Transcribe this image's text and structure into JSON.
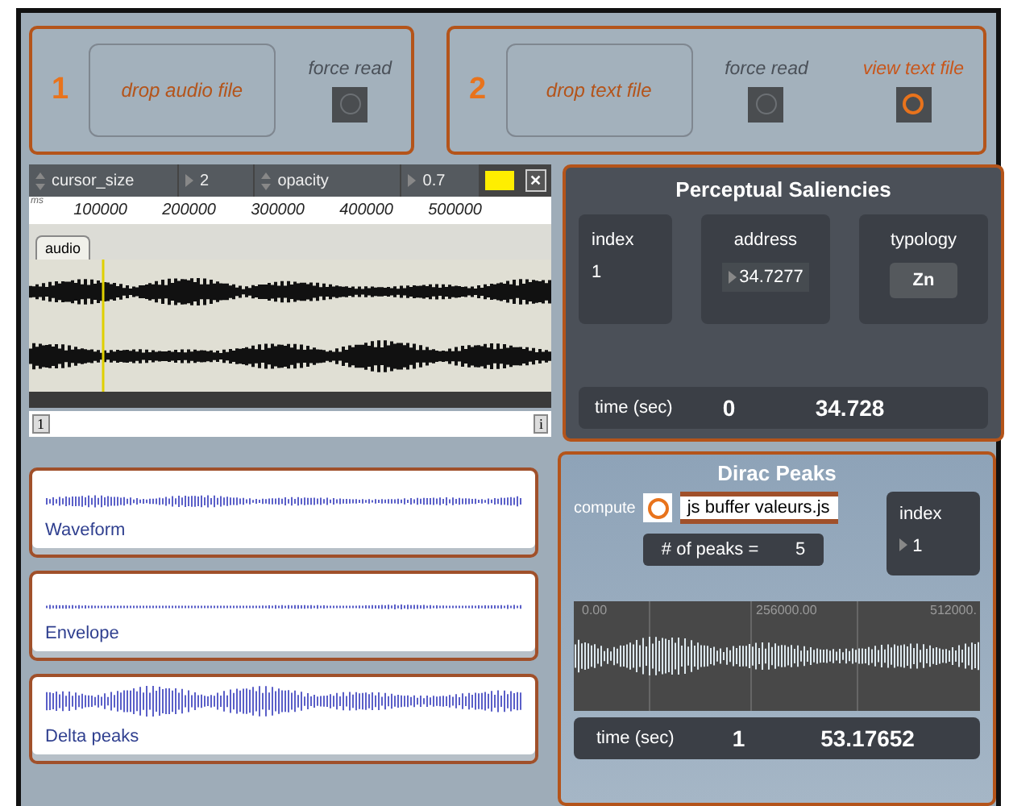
{
  "loaders": [
    {
      "number": "1",
      "drop_label": "drop audio file",
      "toggles": [
        {
          "label": "force read",
          "on": false,
          "kind": "plain"
        }
      ]
    },
    {
      "number": "2",
      "drop_label": "drop text file",
      "toggles": [
        {
          "label": "force read",
          "on": false,
          "kind": "plain"
        },
        {
          "label": "view text file",
          "on": true,
          "kind": "accent"
        }
      ]
    }
  ],
  "toolbar": {
    "fields": [
      {
        "name": "cursor_size",
        "value": "2"
      },
      {
        "name": "opacity",
        "value": "0.7"
      }
    ],
    "close": "✕"
  },
  "ruler": {
    "unit": "ms",
    "ticks": [
      "100000",
      "200000",
      "300000",
      "400000",
      "500000"
    ]
  },
  "editor": {
    "tab": "audio",
    "page": "1",
    "info": "i"
  },
  "saliencies": {
    "title": "Perceptual Saliencies",
    "index_label": "index",
    "index": "1",
    "address_label": "address",
    "address": "34.7277",
    "typology_label": "typology",
    "typology": "Zn",
    "time_label": "time (sec)",
    "time_start": "0",
    "time_end": "34.728"
  },
  "views": [
    {
      "label": "Waveform"
    },
    {
      "label": "Envelope"
    },
    {
      "label": "Delta peaks"
    }
  ],
  "dirac": {
    "title": "Dirac Peaks",
    "compute_label": "compute",
    "compute_on": true,
    "script": "js buffer valeurs.js",
    "peaks_label": "# of peaks =",
    "peaks": "5",
    "index_label": "index",
    "index": "1",
    "axis_labels": [
      "0.00",
      "256000.00",
      "512000."
    ],
    "time_label": "time (sec)",
    "time_start": "1",
    "time_end": "53.17652"
  }
}
